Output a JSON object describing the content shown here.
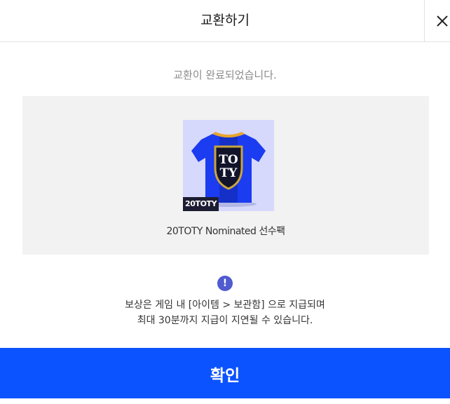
{
  "header": {
    "title": "교환하기",
    "close_icon": "close-icon"
  },
  "status_text": "교환이 완료되었습니다.",
  "reward": {
    "tag": "20TOTY",
    "name": "20TOTY Nominated 선수팩",
    "icon": "jersey-icon"
  },
  "notice": {
    "icon_glyph": "!",
    "line1": "보상은 게임 내 [아이템 > 보관함] 으로 지급되며",
    "line2": "최대 30분까지 지급이 지연될 수 있습니다."
  },
  "confirm_label": "확인",
  "colors": {
    "primary_button": "#0b53ff",
    "notice_icon": "#4f5bcf",
    "reward_bg": "#f2f2f2",
    "thumb_bg": "#d6d9fb",
    "jersey_blue": "#1b3cf0"
  }
}
